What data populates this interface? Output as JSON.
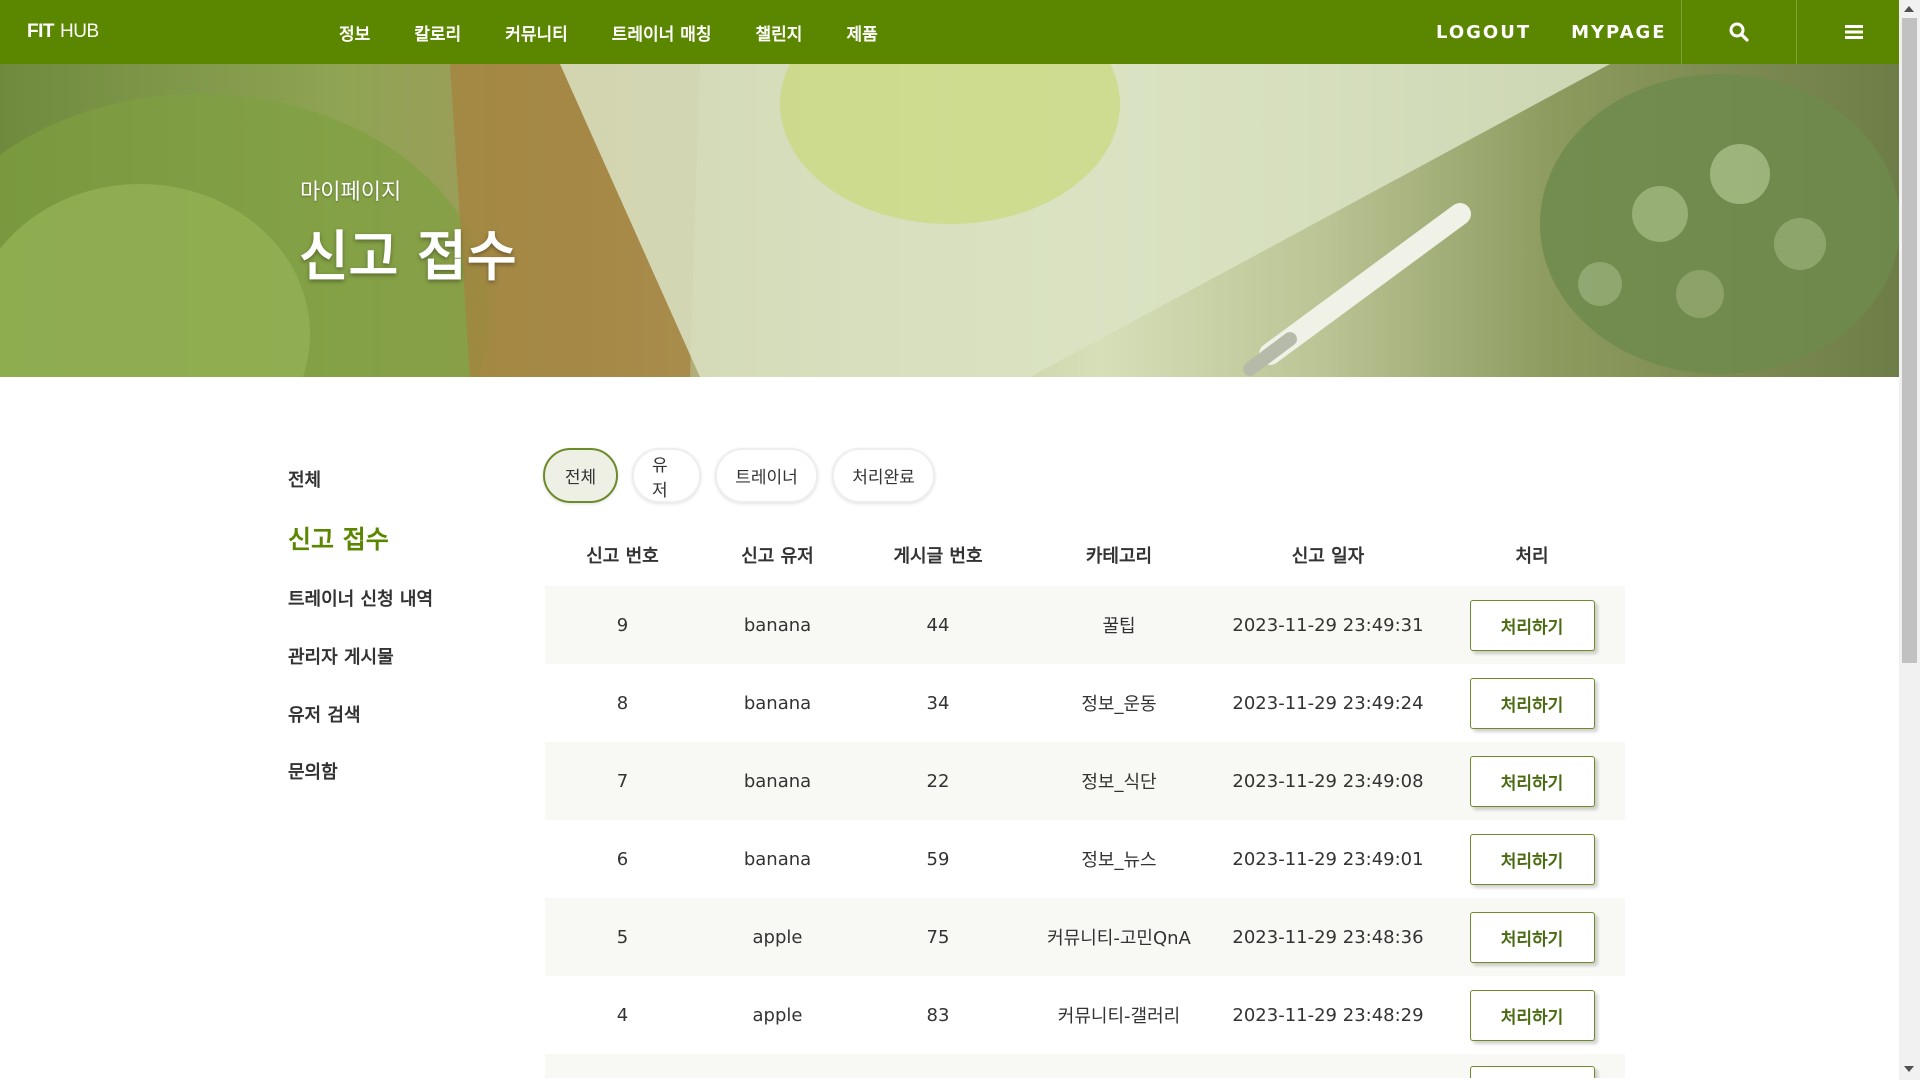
{
  "nav": {
    "brand_bold": "FIT",
    "brand_rest": "HUB",
    "menu": [
      "정보",
      "칼로리",
      "커뮤니티",
      "트레이너 매칭",
      "챌린지",
      "제품"
    ],
    "logout": "LOGOUT",
    "mypage": "MYPAGE",
    "search_icon": "search-icon",
    "menu_icon": "hamburger-menu-icon",
    "bg_color": "#5b8700"
  },
  "hero": {
    "subtitle": "마이페이지",
    "title": "신고 접수"
  },
  "sidebar": {
    "items": [
      "전체",
      "신고 접수",
      "트레이너 신청 내역",
      "관리자 게시물",
      "유저 검색",
      "문의함"
    ],
    "active_index": 1,
    "active_color": "#5b8700"
  },
  "filters": {
    "chips": [
      "전체",
      "유저",
      "트레이너",
      "처리완료"
    ],
    "active_index": 0
  },
  "table": {
    "headers": [
      "신고 번호",
      "신고 유저",
      "게시글 번호",
      "카테고리",
      "신고 일자",
      "처리"
    ],
    "rows": [
      {
        "no": "9",
        "user": "banana",
        "post": "44",
        "category": "꿀팁",
        "date": "2023-11-29 23:49:31",
        "action": "처리하기"
      },
      {
        "no": "8",
        "user": "banana",
        "post": "34",
        "category": "정보_운동",
        "date": "2023-11-29 23:49:24",
        "action": "처리하기"
      },
      {
        "no": "7",
        "user": "banana",
        "post": "22",
        "category": "정보_식단",
        "date": "2023-11-29 23:49:08",
        "action": "처리하기"
      },
      {
        "no": "6",
        "user": "banana",
        "post": "59",
        "category": "정보_뉴스",
        "date": "2023-11-29 23:49:01",
        "action": "처리하기"
      },
      {
        "no": "5",
        "user": "apple",
        "post": "75",
        "category": "커뮤니티-고민QnA",
        "date": "2023-11-29 23:48:36",
        "action": "처리하기"
      },
      {
        "no": "4",
        "user": "apple",
        "post": "83",
        "category": "커뮤니티-갤러리",
        "date": "2023-11-29 23:48:29",
        "action": "처리하기"
      }
    ]
  }
}
